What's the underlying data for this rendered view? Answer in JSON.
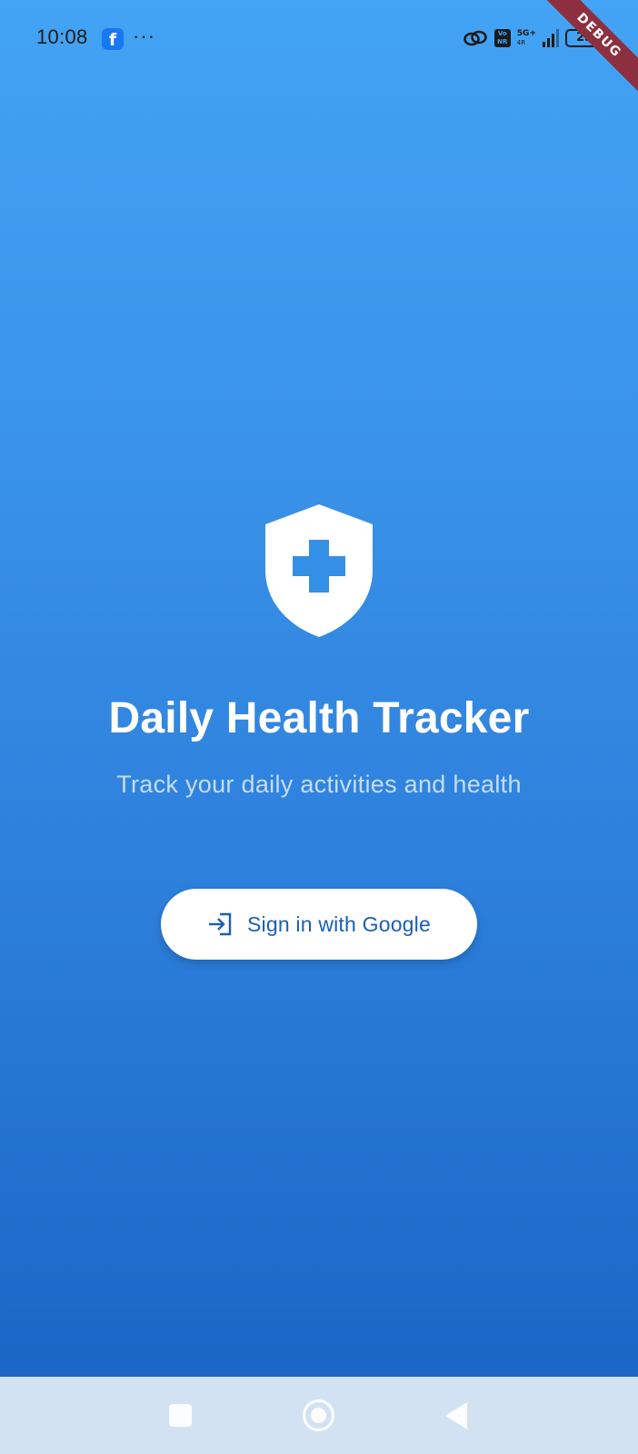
{
  "status_bar": {
    "time": "10:08",
    "facebook_glyph": "f",
    "more_glyph": "···",
    "vonr_top": "Vo",
    "vonr_bottom": "NR",
    "network_type": "5G+",
    "network_sub": "4R",
    "battery_level": "25"
  },
  "debug_banner": "DEBUG",
  "app": {
    "title": "Daily Health Tracker",
    "subtitle": "Track your daily activities and health",
    "logo_icon": "shield-plus-icon"
  },
  "signin": {
    "label": "Sign in with Google",
    "icon": "login-icon"
  },
  "colors": {
    "gradient_top": "#43a3f4",
    "gradient_bottom": "#1862c2",
    "button_text": "#1a5fb4",
    "debug_banner": "#8c2f3f",
    "nav_bar": "#d3e2f3"
  },
  "nav_bar": {
    "recents_icon": "square-icon",
    "home_icon": "circle-icon",
    "back_icon": "triangle-back-icon"
  }
}
